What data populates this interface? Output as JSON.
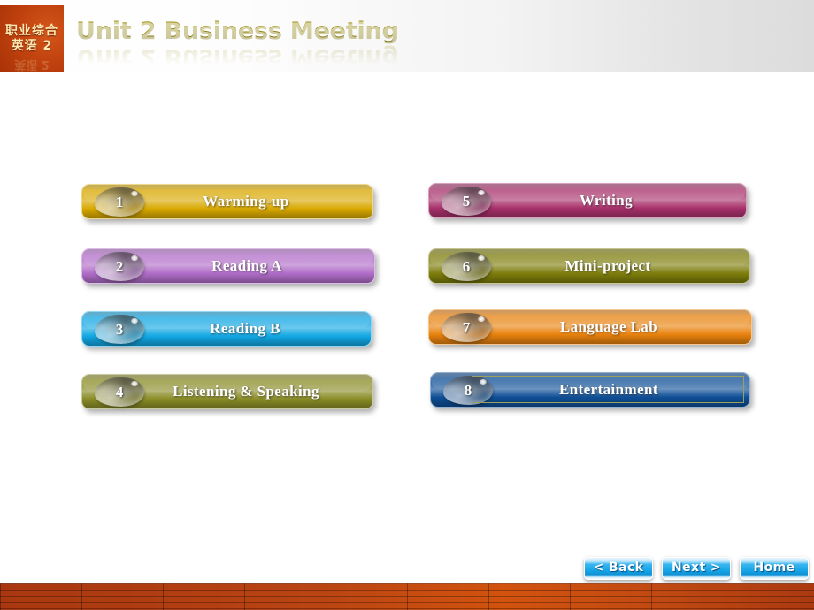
{
  "header": {
    "logo_line1": "职业综合",
    "logo_line2": "英语 2",
    "title": "Unit 2 Business Meeting",
    "title_color": "#8a7d12",
    "logo_bg_color": "#c2430f"
  },
  "menu": {
    "items": [
      {
        "number": "1",
        "label": "Warming-up",
        "color": "#d8a800",
        "selected": false
      },
      {
        "number": "2",
        "label": "Reading  A",
        "color": "#b06cc8",
        "selected": false
      },
      {
        "number": "3",
        "label": "Reading  B",
        "color": "#11a7e3",
        "selected": false
      },
      {
        "number": "4",
        "label": "Listening  & Speaking",
        "color": "#8a8c27",
        "selected": false
      },
      {
        "number": "5",
        "label": "Writing",
        "color": "#a8316b",
        "selected": false
      },
      {
        "number": "6",
        "label": "Mini-project",
        "color": "#7e7d0c",
        "selected": false
      },
      {
        "number": "7",
        "label": "Language  Lab",
        "color": "#e8820e",
        "selected": false
      },
      {
        "number": "8",
        "label": "Entertainment",
        "color": "#0f4f96",
        "selected": true
      }
    ]
  },
  "nav": {
    "back_label": "< Back",
    "next_label": "Next >",
    "home_label": "Home",
    "button_color": "#17a6e8"
  },
  "footer": {
    "wall_color": "#bb4512"
  }
}
